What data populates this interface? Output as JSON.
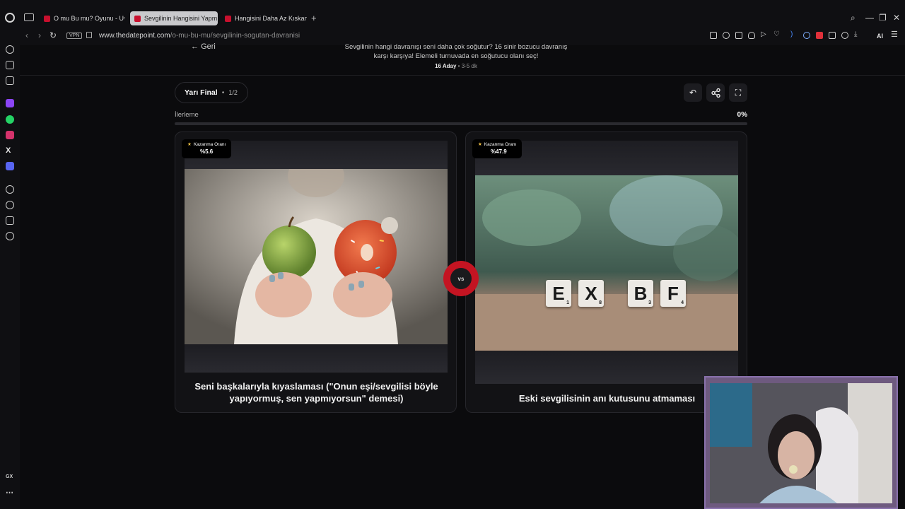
{
  "browser": {
    "tabs": [
      {
        "label": "O mu Bu mu? Oyunu - Uw",
        "active": false
      },
      {
        "label": "Sevgilinin Hangisini Yapm",
        "active": true
      },
      {
        "label": "Hangisini Daha Az Kıskanı",
        "active": false
      }
    ],
    "vpn_label": "VPN",
    "url_domain": "www.thedatepoint.com",
    "url_path": "/o-mu-bu-mu/sevgilinin-sogutan-davranisi",
    "ai_label": "AI",
    "sidebar_gx_label": "GX"
  },
  "page": {
    "back_label": "Geri",
    "intro_text": "Sevgilinin hangi davranışı seni daha çok soğutur? 16 sinir bozucu davranış karşı karşıya! Elemeli turnuvada en soğutucu olanı seç!",
    "candidates_count": "16 Aday",
    "duration": "3-5 dk",
    "round_name": "Yarı Final",
    "round_progress": "1/2",
    "progress_label": "İlerleme",
    "progress_percent": "0%",
    "progress_value": 0,
    "vs_label": "vs",
    "cards": [
      {
        "win_rate_label": "Kazanma Oranı",
        "win_rate_value": "%5.6",
        "title": "Seni başkalarıyla kıyaslaması (\"Onun eşi/sevgilisi böyle yapıyormuş, sen yapmıyorsun\" demesi)"
      },
      {
        "win_rate_label": "Kazanma Oranı",
        "win_rate_value": "%47.9",
        "title": "Eski sevgilisinin anı kutusunu atmaması"
      }
    ],
    "tiles": [
      "E",
      "X",
      "B",
      "F"
    ],
    "tile_numbers": [
      "1",
      "8",
      "3",
      "4"
    ]
  },
  "colors": {
    "accent_red": "#c41422",
    "background": "#0b0b0d"
  }
}
